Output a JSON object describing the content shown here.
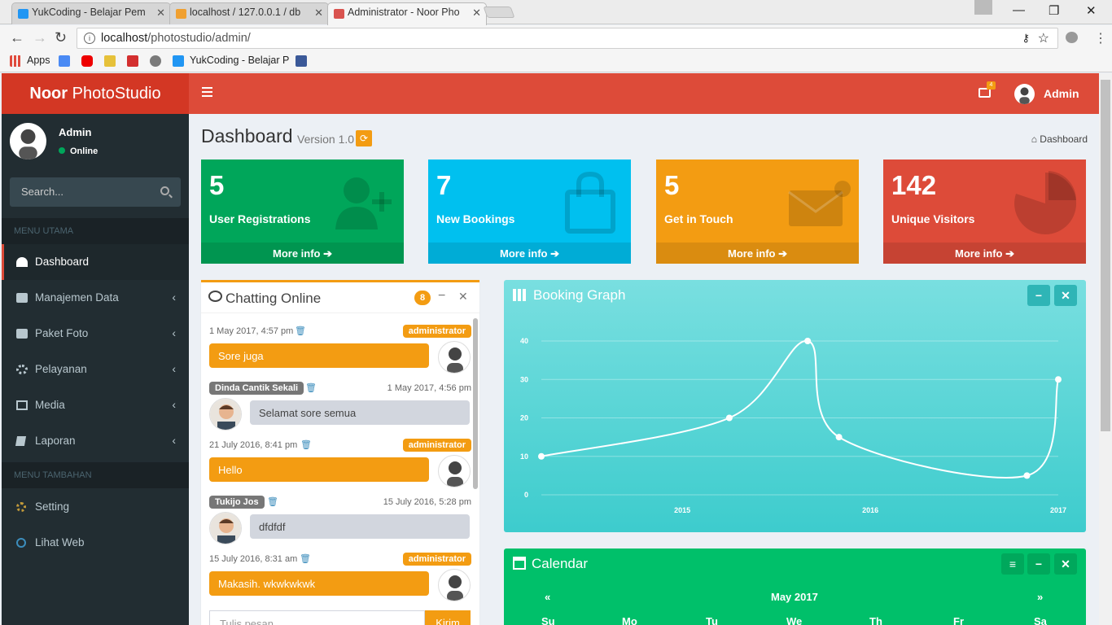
{
  "browser": {
    "tabs": [
      {
        "title": "YukCoding - Belajar Pem"
      },
      {
        "title": "localhost / 127.0.0.1 / db"
      },
      {
        "title": "Administrator - Noor Pho"
      }
    ],
    "url_host": "localhost",
    "url_path": "/photostudio/admin/",
    "bookmarks": {
      "apps": "Apps",
      "yukcoding": "YukCoding - Belajar P"
    }
  },
  "app": {
    "logo_bold": "Noor",
    "logo_rest": "PhotoStudio",
    "mail_count": "4",
    "top_user": "Admin"
  },
  "sidebar": {
    "user_name": "Admin",
    "status": "Online",
    "search_placeholder": "Search...",
    "header_main": "MENU UTAMA",
    "header_extra": "MENU TAMBAHAN",
    "items": [
      {
        "label": "Dashboard",
        "icon": "dashboard-icon"
      },
      {
        "label": "Manajemen Data",
        "icon": "camera-icon"
      },
      {
        "label": "Paket Foto",
        "icon": "camera-icon"
      },
      {
        "label": "Pelayanan",
        "icon": "gears-icon"
      },
      {
        "label": "Media",
        "icon": "film-icon"
      },
      {
        "label": "Laporan",
        "icon": "book-icon"
      },
      {
        "label": "Setting",
        "icon": "gear-icon"
      },
      {
        "label": "Lihat Web",
        "icon": "circle-icon"
      }
    ]
  },
  "page": {
    "title": "Dashboard",
    "version": "Version 1.0",
    "breadcrumb": "Dashboard"
  },
  "stats": [
    {
      "value": "5",
      "label": "User Registrations",
      "more": "More info",
      "color": "#00a65a"
    },
    {
      "value": "7",
      "label": "New Bookings",
      "more": "More info",
      "color": "#00c0ef"
    },
    {
      "value": "5",
      "label": "Get in Touch",
      "more": "More info",
      "color": "#f39c12"
    },
    {
      "value": "142",
      "label": "Unique Visitors",
      "more": "More info",
      "color": "#dd4b39"
    }
  ],
  "chat": {
    "title": "Chatting Online",
    "badge": "8",
    "input_placeholder": "Tulis pesan...",
    "send": "Kirim",
    "messages": [
      {
        "name": "administrator",
        "time": "1 May 2017, 4:57 pm",
        "text": "Sore juga",
        "side": "right"
      },
      {
        "name": "Dinda Cantik Sekali",
        "time": "1 May 2017, 4:56 pm",
        "text": "Selamat sore semua",
        "side": "left"
      },
      {
        "name": "administrator",
        "time": "21 July 2016, 8:41 pm",
        "text": "Hello",
        "side": "right"
      },
      {
        "name": "Tukijo Jos",
        "time": "15 July 2016, 5:28 pm",
        "text": "dfdfdf",
        "side": "left"
      },
      {
        "name": "administrator",
        "time": "15 July 2016, 8:31 am",
        "text": "Makasih. wkwkwkwk",
        "side": "right"
      }
    ]
  },
  "graph": {
    "title": "Booking Graph",
    "color": "#39cccc"
  },
  "chart_data": {
    "type": "line",
    "x": [
      "2014-10",
      "2015-10",
      "2016-03",
      "2016-05",
      "2017-05",
      "2017-07"
    ],
    "series": [
      {
        "values": [
          10,
          20,
          40,
          15,
          5,
          30
        ]
      }
    ],
    "x_ticks": [
      "2015",
      "2016",
      "2017"
    ],
    "y_ticks": [
      "0",
      "10",
      "20",
      "30",
      "40"
    ],
    "ylim": [
      0,
      40
    ],
    "grid": true
  },
  "calendar": {
    "title": "Calendar",
    "month": "May 2017",
    "prev": "«",
    "next": "»",
    "days": [
      "Su",
      "Mo",
      "Tu",
      "We",
      "Th",
      "Fr",
      "Sa"
    ],
    "color": "#00c06a"
  }
}
